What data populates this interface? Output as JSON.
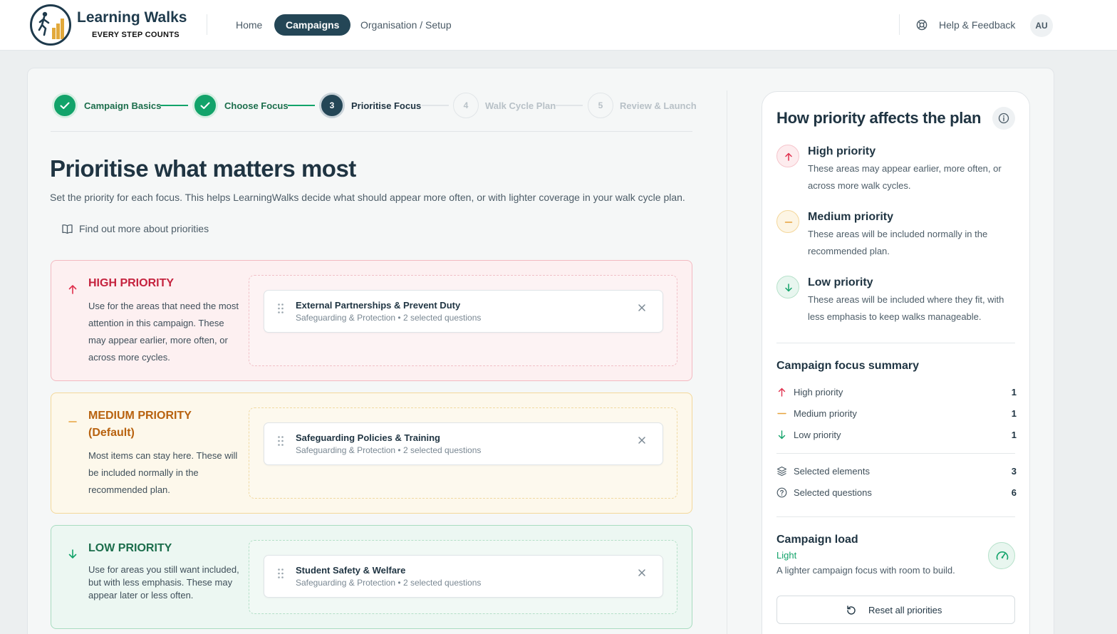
{
  "app": {
    "logo_title": "Learning Walks",
    "logo_tagline": "EVERY STEP COUNTS"
  },
  "nav": {
    "home": "Home",
    "campaigns": "Campaigns",
    "organisation": "Organisation / Setup",
    "help": "Help & Feedback",
    "avatar_initials": "AU"
  },
  "stepper": [
    {
      "number": "1",
      "label": "Campaign Basics",
      "state": "done"
    },
    {
      "number": "2",
      "label": "Choose Focus",
      "state": "done"
    },
    {
      "number": "3",
      "label": "Prioritise Focus",
      "state": "current"
    },
    {
      "number": "4",
      "label": "Walk Cycle Plan",
      "state": "todo"
    },
    {
      "number": "5",
      "label": "Review & Launch",
      "state": "todo"
    }
  ],
  "page": {
    "title": "Prioritise what matters most",
    "description": "Set the priority for each focus. This helps LearningWalks decide what should appear more often, or with lighter coverage in your walk cycle plan.",
    "find_out_more": "Find out more about priorities"
  },
  "priorities": {
    "high": {
      "title": "HIGH PRIORITY",
      "description": "Use for the areas that need the most attention in this campaign. These may appear earlier, more often, or across more cycles.",
      "items": [
        {
          "name": "External Partnerships & Prevent Duty",
          "meta": "Safeguarding & Protection • 2 selected questions"
        }
      ]
    },
    "medium": {
      "title": "MEDIUM PRIORITY (Default)",
      "description": "Most items can stay here. These will be included normally in the recommended plan.",
      "items": [
        {
          "name": "Safeguarding Policies & Training",
          "meta": "Safeguarding & Protection • 2 selected questions"
        }
      ]
    },
    "low": {
      "title": "LOW PRIORITY",
      "description": "Use for areas you still want included, but with less emphasis. These may appear later or less often.",
      "items": [
        {
          "name": "Student Safety & Welfare",
          "meta": "Safeguarding & Protection • 2 selected questions"
        }
      ]
    }
  },
  "panel": {
    "title": "How priority affects the plan",
    "legend": {
      "high": {
        "title": "High priority",
        "desc": "These areas may appear earlier, more often, or across more walk cycles."
      },
      "medium": {
        "title": "Medium priority",
        "desc": "These areas will be included normally in the recommended plan."
      },
      "low": {
        "title": "Low priority",
        "desc": "These areas will be included where they fit, with less emphasis to keep walks manageable."
      }
    },
    "summary": {
      "title": "Campaign focus summary",
      "high_label": "High priority",
      "high_count": "1",
      "medium_label": "Medium priority",
      "medium_count": "1",
      "low_label": "Low priority",
      "low_count": "1",
      "elements_label": "Selected elements",
      "elements_count": "3",
      "questions_label": "Selected questions",
      "questions_count": "6"
    },
    "load": {
      "title": "Campaign load",
      "level": "Light",
      "desc": "A lighter campaign focus with room to build."
    },
    "reset_label": "Reset all priorities"
  },
  "colors": {
    "primary": "#244656",
    "success": "#12a36a",
    "high": "#e0314e",
    "medium": "#e6a23c",
    "low": "#12a36a"
  },
  "icons": {
    "logo": "walker-stairs-logo",
    "help": "lifebuoy-icon",
    "check": "check-icon",
    "book": "book-open-icon",
    "arrow_up": "arrow-up-icon",
    "minus": "minus-icon",
    "arrow_down": "arrow-down-icon",
    "grip": "drag-handle-icon",
    "close": "close-icon",
    "info": "info-icon",
    "layers": "layers-icon",
    "question": "question-circle-icon",
    "gauge": "gauge-icon",
    "reset": "rotate-ccw-icon"
  }
}
